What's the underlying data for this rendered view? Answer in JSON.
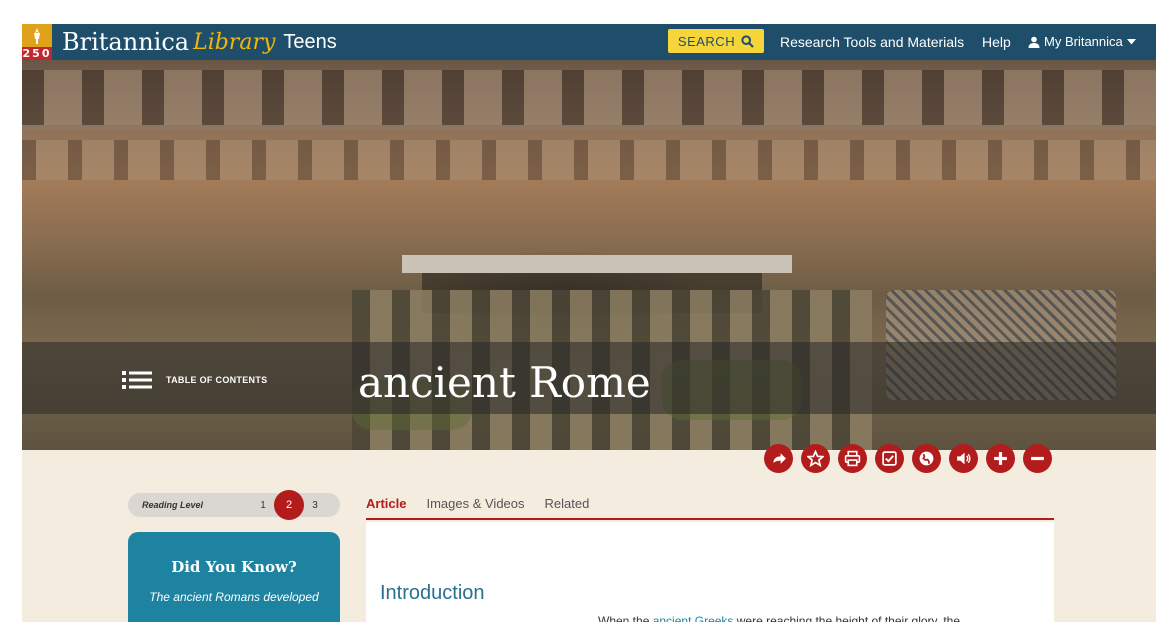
{
  "header": {
    "logo_number": "250",
    "brand": "Britannica",
    "library": "Library",
    "edition": "Teens",
    "search_label": "SEARCH",
    "nav": {
      "research": "Research Tools and Materials",
      "help": "Help",
      "my": "My Britannica"
    }
  },
  "hero": {
    "toc_label": "TABLE OF CONTENTS",
    "title": "ancient Rome"
  },
  "actions": [
    "share-icon",
    "star-icon",
    "print-icon",
    "checklist-icon",
    "globe-icon",
    "audio-icon",
    "zoom-in-icon",
    "zoom-out-icon"
  ],
  "reading_level": {
    "label": "Reading Level",
    "levels": [
      "1",
      "2",
      "3"
    ],
    "selected": "2"
  },
  "did_you_know": {
    "title": "Did You Know?",
    "text": "The ancient Romans developed"
  },
  "tabs": [
    "Article",
    "Images & Videos",
    "Related"
  ],
  "article": {
    "section_heading": "Introduction",
    "line_start": "When the ",
    "line_link": "ancient Greeks",
    "line_end": " were reaching the height of their glory, the"
  },
  "colors": {
    "header_bg": "#1f4e6b",
    "search_bg": "#f5d53a",
    "accent_red": "#b31c1c",
    "teal": "#1d83a0",
    "page_bg": "#f4ecdf"
  }
}
